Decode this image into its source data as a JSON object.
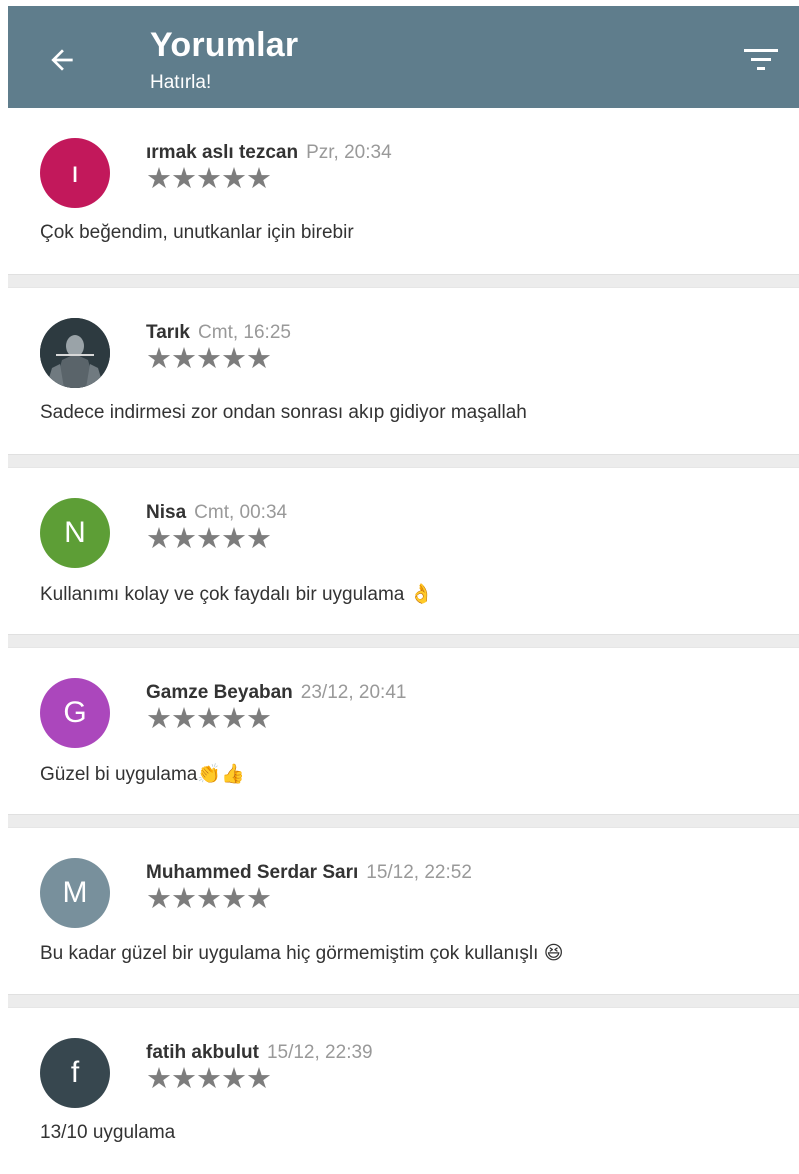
{
  "header": {
    "title": "Yorumlar",
    "subtitle": "Hatırla!",
    "back_icon": "arrow-back-icon",
    "filter_icon": "filter-icon",
    "color": "#5f7d8c"
  },
  "reviews": [
    {
      "initial": "ı",
      "avatar_color": "#c2185b",
      "name": "ırmak aslı tezcan",
      "time": "Pzr, 20:34",
      "stars": "★★★★★",
      "text": "Çok beğendim, unutkanlar için birebir"
    },
    {
      "initial": "",
      "avatar_color": "#2d3a40",
      "name": "Tarık",
      "time": "Cmt, 16:25",
      "stars": "★★★★★",
      "text": "Sadece indirmesi zor ondan sonrası akıp gidiyor maşallah"
    },
    {
      "initial": "N",
      "avatar_color": "#5d9e36",
      "name": "Nisa",
      "time": "Cmt, 00:34",
      "stars": "★★★★★",
      "text": "Kullanımı kolay ve çok faydalı bir uygulama 👌"
    },
    {
      "initial": "G",
      "avatar_color": "#ab47bc",
      "name": "Gamze Beyaban",
      "time": "23/12, 20:41",
      "stars": "★★★★★",
      "text": "Güzel bi uygulama👏👍"
    },
    {
      "initial": "M",
      "avatar_color": "#78909c",
      "name": "Muhammed Serdar Sarı",
      "time": "15/12, 22:52",
      "stars": "★★★★★",
      "text": "Bu kadar güzel bir uygulama hiç görmemiştim çok kullanışlı 😆"
    },
    {
      "initial": "f",
      "avatar_color": "#37474f",
      "name": "fatih akbulut",
      "time": "15/12, 22:39",
      "stars": "★★★★★",
      "text": "13/10 uygulama"
    }
  ]
}
